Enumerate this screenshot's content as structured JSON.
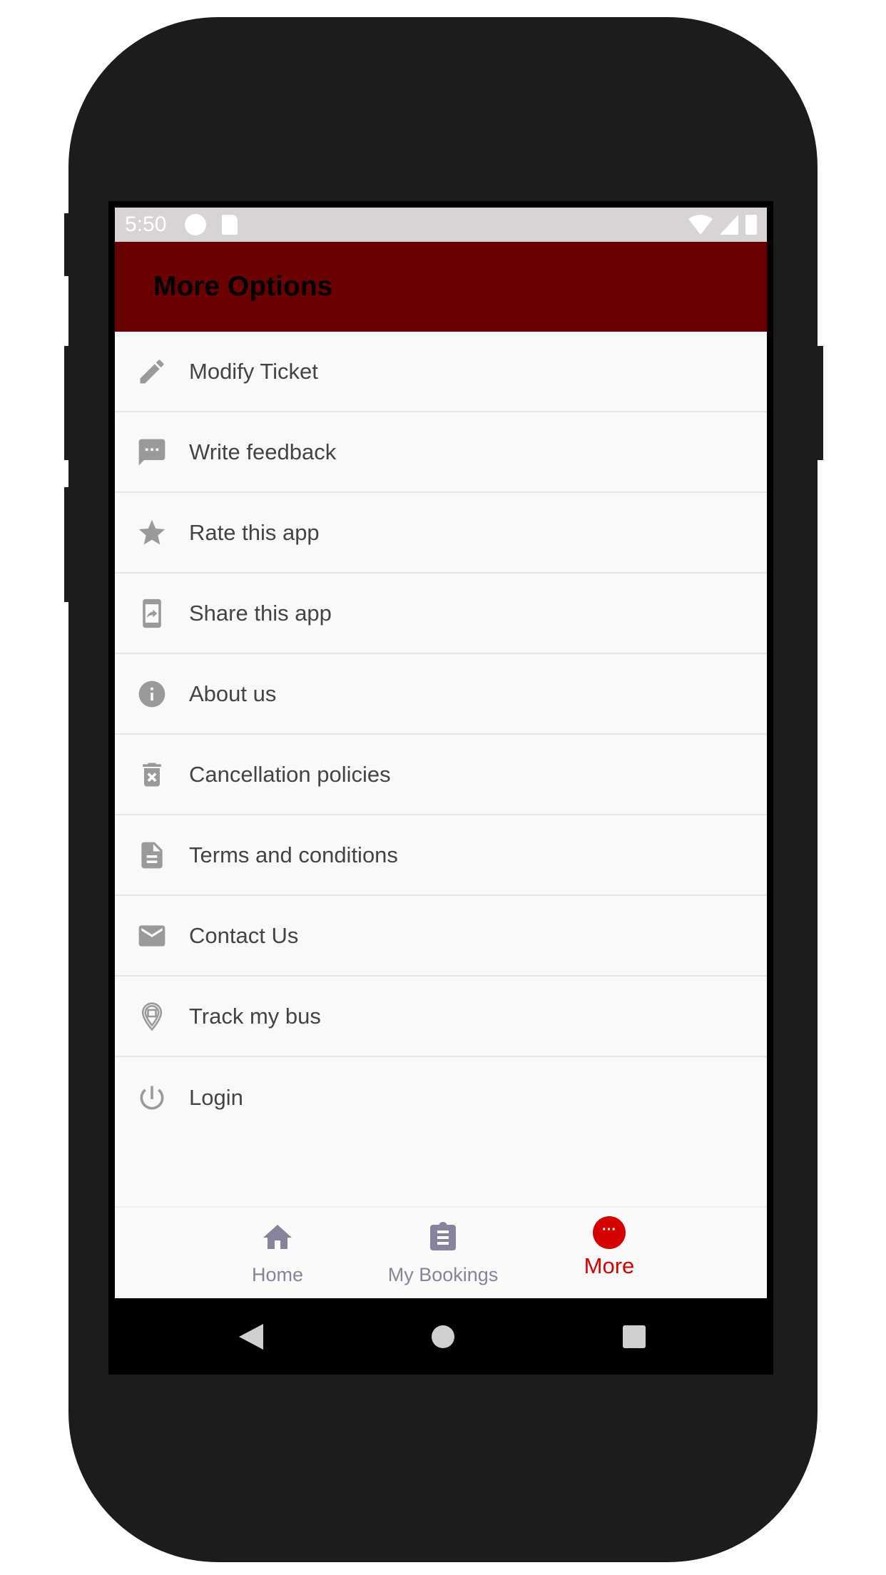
{
  "status_bar": {
    "time": "5:50"
  },
  "app_bar": {
    "title": "More Options"
  },
  "menu": [
    {
      "label": "Modify Ticket",
      "icon": "pencil-icon"
    },
    {
      "label": "Write feedback",
      "icon": "feedback-icon"
    },
    {
      "label": "Rate this app",
      "icon": "star-icon"
    },
    {
      "label": "Share this app",
      "icon": "share-icon"
    },
    {
      "label": "About us",
      "icon": "info-icon"
    },
    {
      "label": "Cancellation policies",
      "icon": "delete-icon"
    },
    {
      "label": "Terms and conditions",
      "icon": "document-icon"
    },
    {
      "label": "Contact Us",
      "icon": "mail-icon"
    },
    {
      "label": "Track my bus",
      "icon": "bus-location-icon"
    },
    {
      "label": "Login",
      "icon": "power-icon"
    }
  ],
  "bottom_nav": {
    "items": [
      {
        "label": "Home"
      },
      {
        "label": "My Bookings"
      },
      {
        "label": "More",
        "active": true
      }
    ]
  },
  "colors": {
    "app_bar": "#6b0000",
    "active": "#d50000",
    "inactive": "#86849c"
  }
}
